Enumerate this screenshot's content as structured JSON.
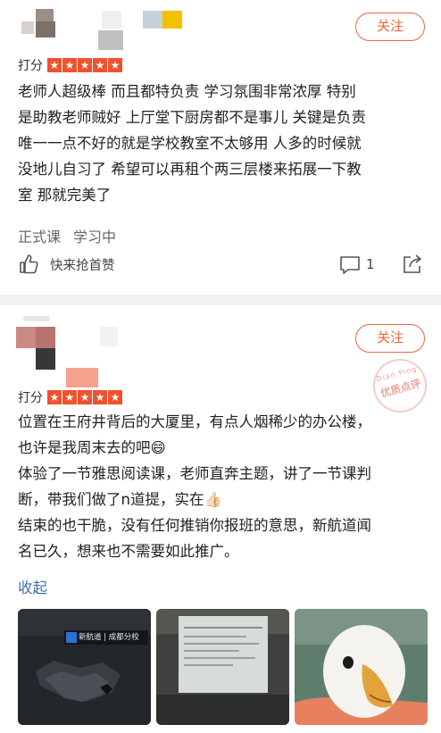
{
  "reviews": [
    {
      "follow_label": "关注",
      "rating_label": "打分",
      "stars": [
        "★",
        "★",
        "★",
        "★",
        "★"
      ],
      "text_lines": [
        "老师人超级棒 而且都特负责 学习氛围非常浓厚 特别",
        "是助教老师贼好 上厅堂下厨房都不是事儿 关键是负责",
        "唯一一点不好的就是学校教室不太够用 人多的时候就",
        "没地儿自习了 希望可以再租个两三层楼来拓展一下教",
        "室 那就完美了"
      ],
      "tags": [
        "正式课",
        "学习中"
      ],
      "like_label": "快来抢首赞",
      "comment_count": "1"
    },
    {
      "follow_label": "关注",
      "rating_label": "打分",
      "stars": [
        "★",
        "★",
        "★",
        "★",
        "★"
      ],
      "stamp_top": "Dian Ping",
      "stamp_main": "优质点评",
      "text_lines": [
        "位置在王府井背后的大厦里，有点人烟稀少的办公楼，",
        "也许是我周末去的吧😄",
        "体验了一节雅思阅读课，老师直奔主题，讲了一节课判",
        "断，带我们做了n道提，实在👍🏻",
        "结束的也干脆，没有任何推销你报班的意思，新航道闻",
        "名已久，想来也不需要如此推广。"
      ],
      "collapse_label": "收起",
      "photos": [
        {
          "icon": "office-photo",
          "caption": "新航道 | 成都分校"
        },
        {
          "icon": "classroom-slide-photo",
          "caption": ""
        },
        {
          "icon": "duck-photo",
          "caption": ""
        }
      ]
    }
  ],
  "colors": {
    "accent": "#f0663c",
    "star_bg": "#f0512e",
    "link": "#3d6fa8",
    "separator": "#f2f2f2"
  }
}
